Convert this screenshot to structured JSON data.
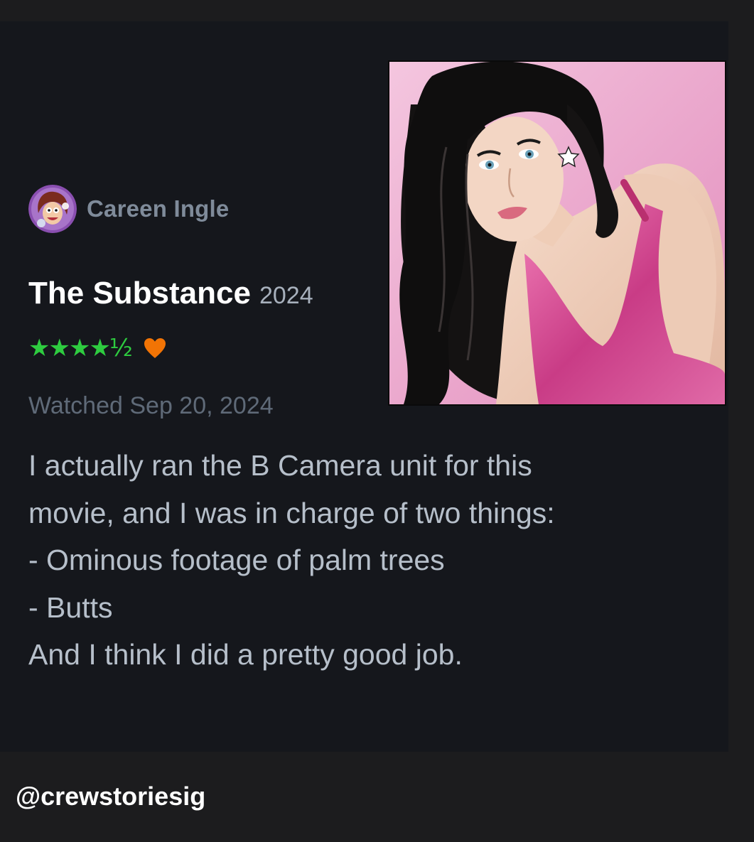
{
  "review": {
    "author": {
      "name": "Careen Ingle",
      "avatar_icon": "cartoon-avatar-icon"
    },
    "film": {
      "title": "The Substance",
      "year": "2024"
    },
    "rating": {
      "stars_text": "★★★★½",
      "value": 4.5,
      "max": 5,
      "liked": true,
      "star_color": "#2ecc40",
      "heart_color": "#f27405"
    },
    "watched_date": "Watched Sep 20, 2024",
    "body_lines": [
      "I actually ran the B Camera unit for this",
      "movie, and I was in charge of two things:",
      "- Ominous footage of palm trees",
      "- Butts",
      "And I think I did a pretty good job."
    ],
    "poster_icon": "film-poster-image"
  },
  "watermark": "@crewstoriesig",
  "colors": {
    "background": "#1c1c1e",
    "card": "#15171c",
    "poster_pink": "#e9a3c8"
  }
}
